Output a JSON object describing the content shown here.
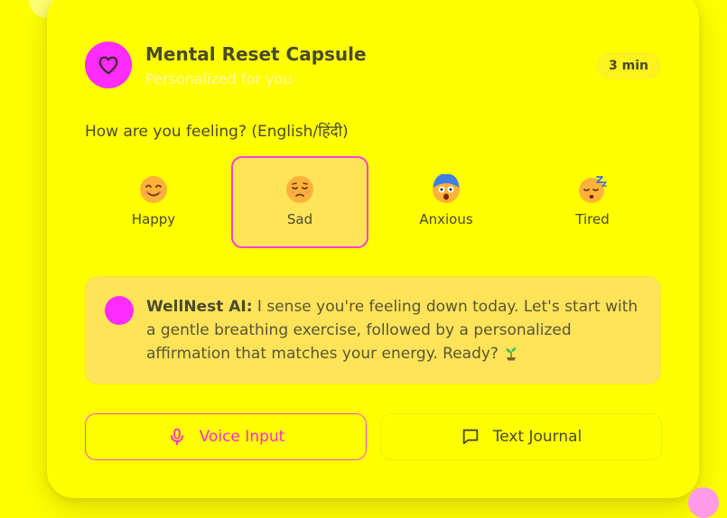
{
  "header": {
    "title": "Mental Reset Capsule",
    "subtitle": "Personalized for you",
    "duration": "3 min",
    "icon": "heart-icon"
  },
  "question": "How are you feeling? (English/हिंदी)",
  "moods": [
    {
      "label": "Happy",
      "icon": "smiling-face-icon",
      "selected": false
    },
    {
      "label": "Sad",
      "icon": "sad-face-icon",
      "selected": true
    },
    {
      "label": "Anxious",
      "icon": "anxious-face-icon",
      "selected": false
    },
    {
      "label": "Tired",
      "icon": "sleepy-face-icon",
      "selected": false
    }
  ],
  "ai_message": {
    "name": "WellNest AI:",
    "text": " I sense you're feeling down today. Let's start with a gentle breathing exercise, followed by a personalized affirmation that matches your energy. Ready?",
    "emoji_icon": "seedling-icon"
  },
  "actions": {
    "voice_label": "Voice Input",
    "voice_icon": "microphone-icon",
    "journal_label": "Text Journal",
    "journal_icon": "chat-bubble-icon"
  },
  "colors": {
    "background": "#ffff00",
    "accent": "#ff2bff",
    "panel": "#ffe45a",
    "text": "#4a4a2a",
    "subtitle": "#fff6a8"
  }
}
